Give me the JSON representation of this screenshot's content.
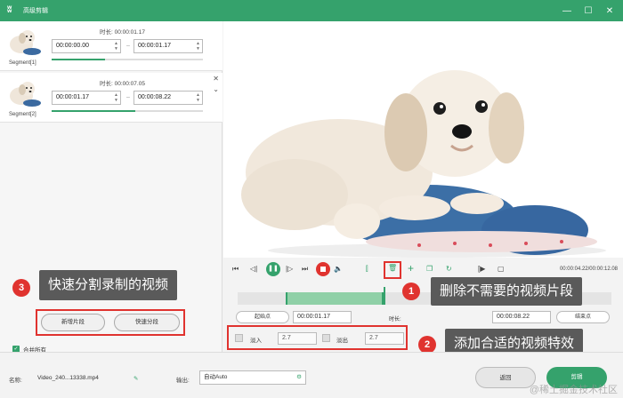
{
  "window": {
    "title": "高级剪辑",
    "logo": "ʬ",
    "minimize_glyph": "—",
    "maximize_glyph": "☐",
    "close_glyph": "✕"
  },
  "segments": [
    {
      "label": "Segment[1]",
      "duration": "时长: 00:00:01.17",
      "start": "00:00:00.00",
      "end": "00:00:01.17",
      "progress": 0.35
    },
    {
      "label": "Segment[2]",
      "duration": "时长: 00:00:07.05",
      "start": "00:00:01.17",
      "end": "00:00:08.22",
      "progress": 0.55
    }
  ],
  "annotations": {
    "one": {
      "num": "1",
      "text": "删除不需要的视频片段"
    },
    "two": {
      "num": "2",
      "text": "添加合适的视频特效"
    },
    "three": {
      "num": "3",
      "text": "快速分割录制的视频"
    }
  },
  "left_actions": {
    "add_segment": "新增片段",
    "quick_split": "快速分段",
    "merge_all": "合并所有",
    "merge_checked": true
  },
  "player": {
    "time_readout": "00:00:04.22/00:00:12.08",
    "playhead_fraction": 0.39
  },
  "markers": {
    "start_label": "起始点",
    "start_time": "00:00:01.17",
    "duration_label": "时长:",
    "end_time": "00:00:08.22",
    "end_label": "结束点"
  },
  "fade": {
    "in_label": "淡入",
    "in_value": "2.7",
    "out_label": "淡出",
    "out_value": "2.7"
  },
  "bottom": {
    "name_label": "名称:",
    "name_value": "Video_240...13338.mp4",
    "output_label": "输出:",
    "output_value": "自动Auto",
    "back_label": "返回",
    "cut_label": "剪辑"
  },
  "watermark": "@稀土掘金技术社区",
  "colors": {
    "accent": "#35a26c",
    "highlight": "#e0332f"
  }
}
